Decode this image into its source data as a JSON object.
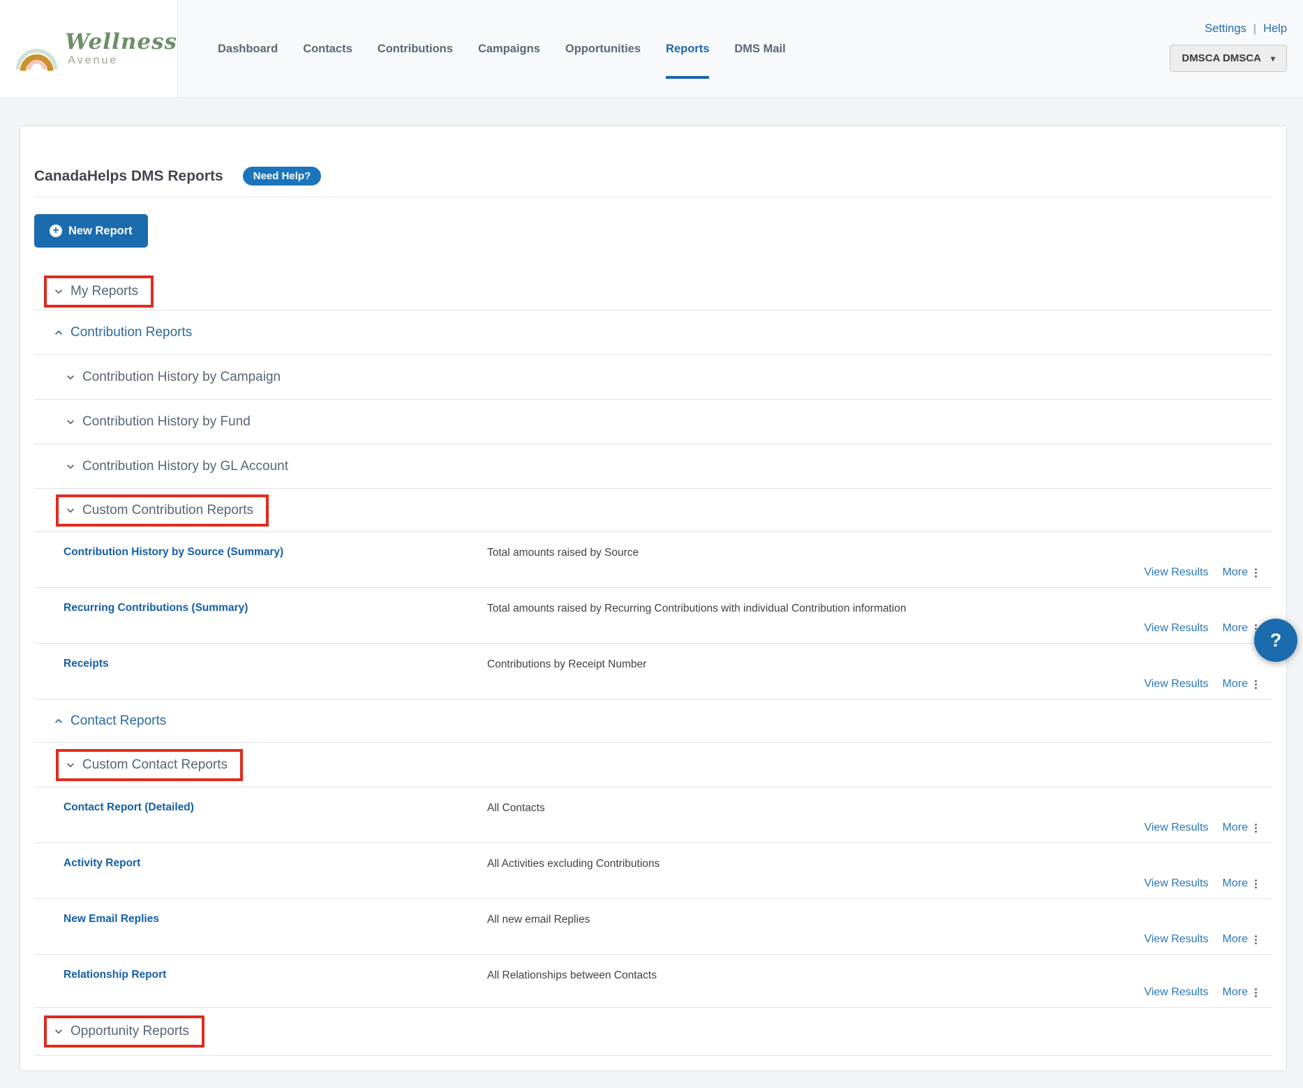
{
  "brand": {
    "name": "Wellness",
    "subname": "Avenue"
  },
  "nav": {
    "items": [
      "Dashboard",
      "Contacts",
      "Contributions",
      "Campaigns",
      "Opportunities",
      "Reports",
      "DMS Mail"
    ],
    "active": "Reports"
  },
  "header_right": {
    "settings": "Settings",
    "separator": "|",
    "help": "Help",
    "account": "DMSCA DMSCA"
  },
  "page": {
    "title": "CanadaHelps DMS Reports",
    "need_help_badge": "Need Help?",
    "new_report_button": "New Report"
  },
  "labels": {
    "view_results": "View Results",
    "more": "More"
  },
  "icons": {
    "plus": "+",
    "caret_down": "▾",
    "more_dots": "⋮",
    "help": "?"
  },
  "rows": [
    {
      "type": "toggle",
      "label": "My Reports",
      "annotated": true
    },
    {
      "type": "toggle",
      "label": "Contribution Reports"
    },
    {
      "type": "toggle",
      "label": "Contribution History by Campaign"
    },
    {
      "type": "toggle",
      "label": "Contribution History by Fund"
    },
    {
      "type": "toggle",
      "label": "Contribution History by GL Account"
    },
    {
      "type": "toggle",
      "label": "Custom Contribution Reports",
      "annotated": true
    },
    {
      "type": "report",
      "title": "Contribution History by Source (Summary)",
      "desc": "Total amounts raised by Source"
    },
    {
      "type": "report",
      "title": "Recurring Contributions (Summary)",
      "desc": "Total amounts raised by Recurring Contributions with individual Contribution information"
    },
    {
      "type": "report",
      "title": "Receipts",
      "desc": "Contributions by Receipt Number"
    },
    {
      "type": "toggle",
      "label": "Contact Reports"
    },
    {
      "type": "toggle",
      "label": "Custom Contact Reports",
      "annotated": true
    },
    {
      "type": "report",
      "title": "Contact Report (Detailed)",
      "desc": "All Contacts"
    },
    {
      "type": "report",
      "title": "Activity Report",
      "desc": "All Activities excluding Contributions"
    },
    {
      "type": "report",
      "title": "New Email Replies",
      "desc": "All new email Replies"
    },
    {
      "type": "report",
      "title": "Relationship Report",
      "desc": "All Relationships between Contacts"
    },
    {
      "type": "toggle",
      "label": "Opportunity Reports",
      "annotated": true
    }
  ],
  "colors": {
    "accent_blue": "#1b6cae",
    "link_blue": "#2a76b8",
    "report_title_blue": "#155fa9",
    "section_blue": "#2a6a9e",
    "section_gray": "#566573",
    "annotation_red": "#e02b1d"
  }
}
